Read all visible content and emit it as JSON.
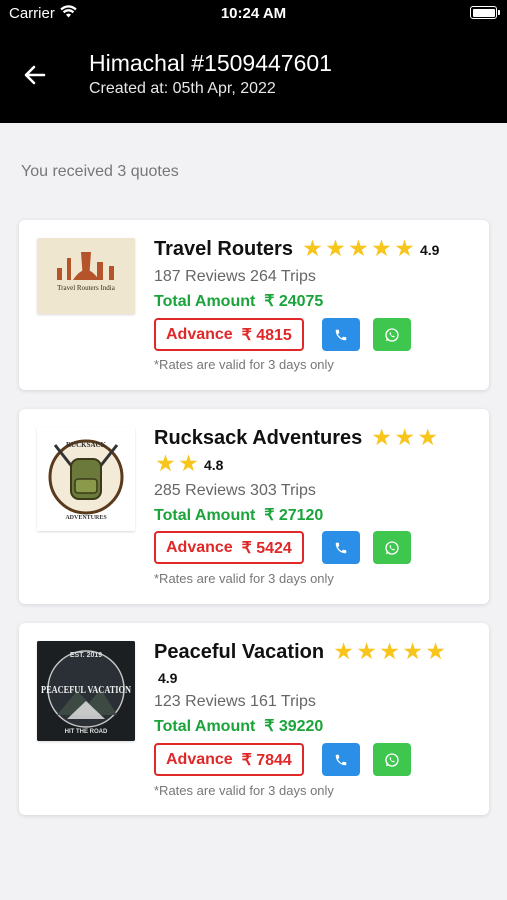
{
  "status_bar": {
    "carrier": "Carrier",
    "time": "10:24 AM"
  },
  "header": {
    "title": "Himachal #1509447601",
    "subtitle": "Created at: 05th Apr, 2022",
    "back_icon": "arrow-left-icon"
  },
  "quotes_count": "You received 3 quotes",
  "colors": {
    "header_bg": "#000000",
    "total_green": "#1aa43a",
    "advance_red": "#e02828",
    "call_blue": "#2b8fe8",
    "whatsapp_green": "#3ec64e",
    "star": "#f7c51c"
  },
  "quotes": [
    {
      "name": "Travel Routers",
      "logo_text": "Travel Routers India",
      "stars": 5,
      "rating": "4.9",
      "reviews": "187 Reviews 264 Trips",
      "total_label": "Total Amount",
      "total_value": "₹ 24075",
      "advance_label": "Advance",
      "advance_value": "₹ 4815",
      "note": "*Rates are valid for 3 days only"
    },
    {
      "name": "Rucksack Adventures",
      "logo_text_top": "RUCKSACK",
      "logo_text_bottom": "ADVENTURES",
      "stars": 5,
      "rating": "4.8",
      "reviews": "285 Reviews 303 Trips",
      "total_label": "Total Amount",
      "total_value": "₹ 27120",
      "advance_label": "Advance",
      "advance_value": "₹ 5424",
      "note": "*Rates are valid for 3 days only"
    },
    {
      "name": "Peaceful Vacation",
      "logo_text_top": "EST. 2019",
      "logo_text_main": "PEACEFUL VACATION",
      "logo_text_bottom": "HIT THE ROAD",
      "stars": 5,
      "rating": "4.9",
      "reviews": "123 Reviews 161 Trips",
      "total_label": "Total Amount",
      "total_value": "₹ 39220",
      "advance_label": "Advance",
      "advance_value": "₹ 7844",
      "note": "*Rates are valid for 3 days only"
    }
  ]
}
